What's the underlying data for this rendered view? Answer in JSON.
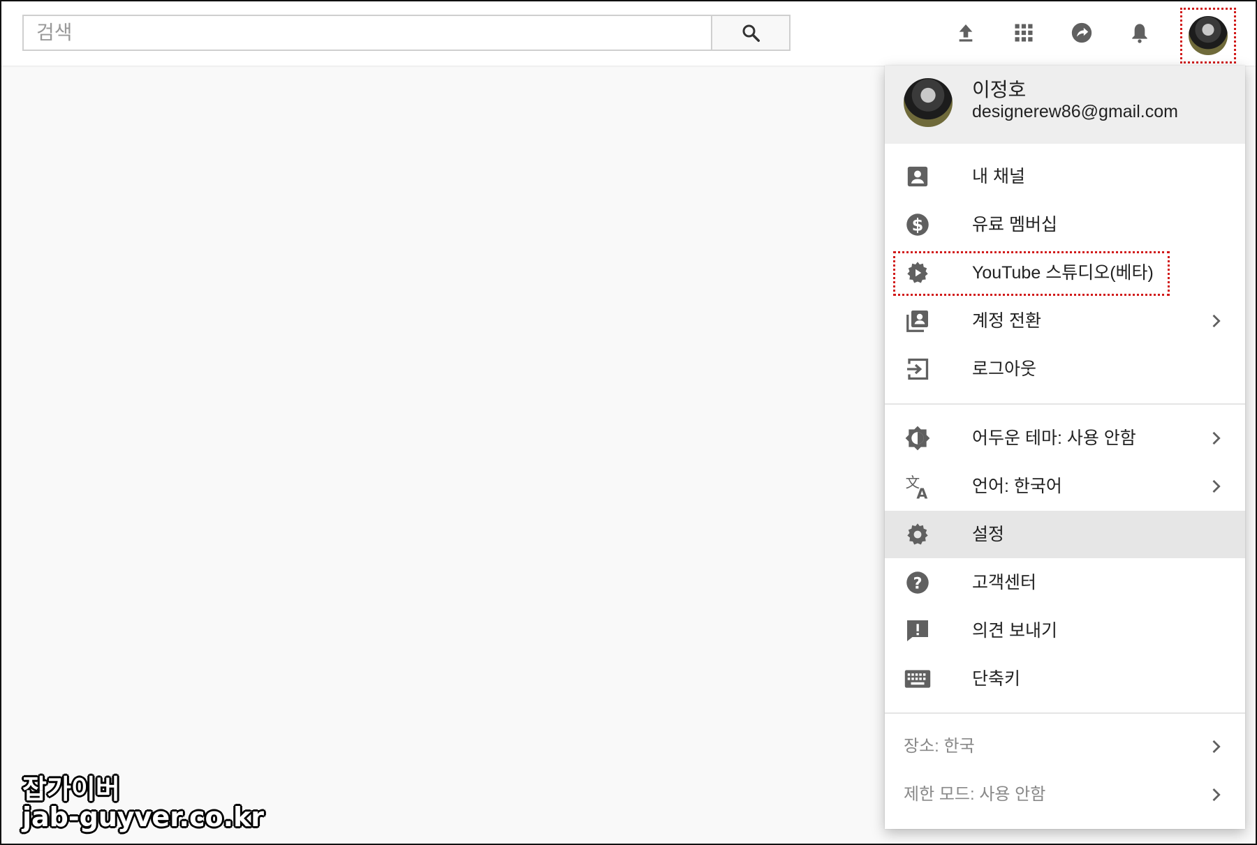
{
  "search": {
    "placeholder": "검색"
  },
  "topbar_icons": [
    "upload-icon",
    "apps-grid-icon",
    "share-icon",
    "notifications-bell-icon",
    "account-avatar"
  ],
  "account": {
    "name": "이정호",
    "email": "designerew86@gmail.com"
  },
  "menu": {
    "group1": [
      {
        "icon": "account-box-icon",
        "label": "내 채널"
      },
      {
        "icon": "dollar-circle-icon",
        "label": "유료 멤버십"
      },
      {
        "icon": "studio-gear-icon",
        "label": "YouTube 스튜디오(베타)"
      },
      {
        "icon": "switch-account-icon",
        "label": "계정 전환"
      },
      {
        "icon": "logout-icon",
        "label": "로그아웃"
      }
    ],
    "group2": [
      {
        "icon": "dark-theme-icon",
        "label": "어두운 테마: 사용 안함"
      },
      {
        "icon": "translate-icon",
        "label": "언어: 한국어"
      },
      {
        "icon": "settings-gear-icon",
        "label": "설정"
      },
      {
        "icon": "help-icon",
        "label": "고객센터"
      },
      {
        "icon": "feedback-icon",
        "label": "의견 보내기"
      },
      {
        "icon": "keyboard-icon",
        "label": "단축키"
      }
    ],
    "group3": [
      {
        "label": "장소: 한국"
      },
      {
        "label": "제한 모드: 사용 안함"
      }
    ]
  },
  "watermark": {
    "line1": "잡가이버",
    "line2": "jab-guyver.co.kr"
  },
  "colors": {
    "highlight": "#d11a1a",
    "icon_gray": "#606060",
    "selected_bg": "#e6e6e6"
  }
}
